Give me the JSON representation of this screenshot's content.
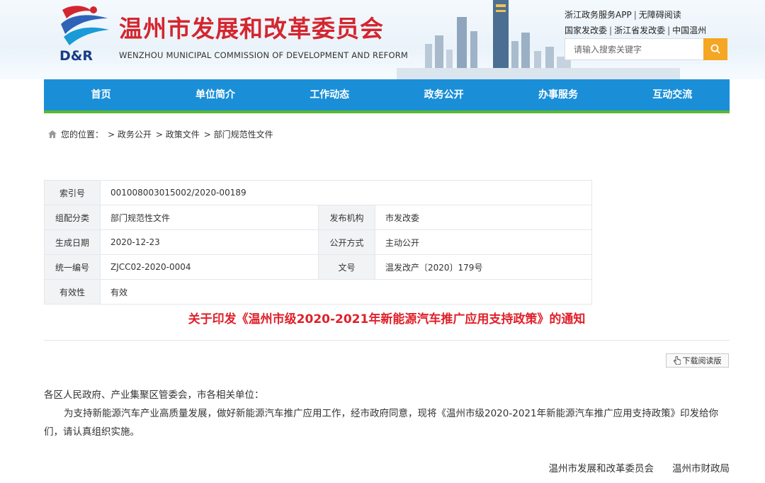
{
  "header": {
    "logo_text": "D&R",
    "title": "温州市发展和改革委员会",
    "subtitle": "WENZHOU MUNICIPAL COMMISSION OF DEVELOPMENT AND REFORM",
    "top_links_row1": [
      "浙江政务服务APP",
      "无障碍阅读"
    ],
    "top_links_row2": [
      "国家发改委",
      "浙江省发改委",
      "中国温州"
    ],
    "search": {
      "placeholder": "请输入搜索关键字",
      "icon": "search-icon"
    }
  },
  "colors": {
    "title_red": "#d4262f",
    "nav_blue": "#1a8fd8",
    "nav_green": "#5cb830",
    "search_orange": "#f5a623",
    "doc_title_red": "#e0202a"
  },
  "nav": {
    "items": [
      "首页",
      "单位简介",
      "工作动态",
      "政务公开",
      "办事服务",
      "互动交流"
    ]
  },
  "breadcrumb": {
    "prefix": "您的位置：",
    "items": [
      "> 政务公开",
      "> 政策文件",
      "> 部门规范性文件"
    ]
  },
  "info": {
    "index_label": "索引号",
    "index_value": "001008003015002/2020-00189",
    "category_label": "组配分类",
    "category_value": "部门规范性文件",
    "publisher_label": "发布机构",
    "publisher_value": "市发改委",
    "date_label": "生成日期",
    "date_value": "2020-12-23",
    "open_label": "公开方式",
    "open_value": "主动公开",
    "code_label": "统一编号",
    "code_value": "ZJCC02-2020-0004",
    "docno_label": "文号",
    "docno_value": "温发改产〔2020〕179号",
    "validity_label": "有效性",
    "validity_value": "有效"
  },
  "document": {
    "title": "关于印发《温州市级2020-2021年新能源汽车推广应用支持政策》的通知",
    "download_label": "下载阅读版",
    "salutation": "各区人民政府、产业集聚区管委会，市各相关单位：",
    "paragraph": "为支持新能源汽车产业高质量发展，做好新能源汽车推广应用工作，经市政府同意，现将《温州市级2020-2021年新能源汽车推广应用支持政策》印发给你们，请认真组织实施。",
    "signers": [
      "温州市发展和改革委员会",
      "温州市财政局"
    ]
  }
}
